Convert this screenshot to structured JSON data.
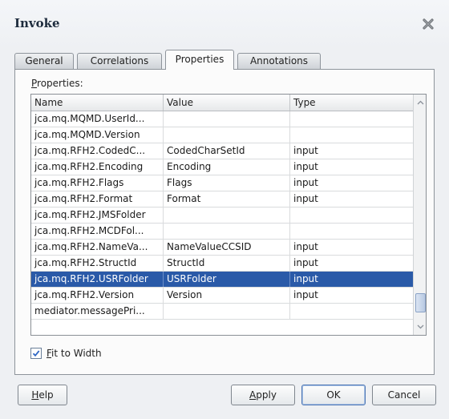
{
  "dialog": {
    "title": "Invoke"
  },
  "tabs": [
    {
      "label": "General",
      "active": false
    },
    {
      "label": "Correlations",
      "active": false
    },
    {
      "label": "Properties",
      "active": true
    },
    {
      "label": "Annotations",
      "active": false
    }
  ],
  "properties": {
    "label_mnemonic": "P",
    "label_rest": "roperties:",
    "columns": [
      "Name",
      "Value",
      "Type"
    ],
    "rows": [
      {
        "name": "jca.mq.MQMD.UserId...",
        "value": "",
        "type": ""
      },
      {
        "name": "jca.mq.MQMD.Version",
        "value": "",
        "type": ""
      },
      {
        "name": "jca.mq.RFH2.CodedC...",
        "value": "CodedCharSetId",
        "type": "input"
      },
      {
        "name": "jca.mq.RFH2.Encoding",
        "value": "Encoding",
        "type": "input"
      },
      {
        "name": "jca.mq.RFH2.Flags",
        "value": "Flags",
        "type": "input"
      },
      {
        "name": "jca.mq.RFH2.Format",
        "value": "Format",
        "type": "input"
      },
      {
        "name": "jca.mq.RFH2.JMSFolder",
        "value": "",
        "type": ""
      },
      {
        "name": "jca.mq.RFH2.MCDFol...",
        "value": "",
        "type": ""
      },
      {
        "name": "jca.mq.RFH2.NameVa...",
        "value": "NameValueCCSID",
        "type": "input"
      },
      {
        "name": "jca.mq.RFH2.StructId",
        "value": "StructId",
        "type": "input"
      },
      {
        "name": "jca.mq.RFH2.USRFolder",
        "value": "USRFolder",
        "type": "input",
        "selected": true
      },
      {
        "name": "jca.mq.RFH2.Version",
        "value": "Version",
        "type": "input"
      },
      {
        "name": "mediator.messagePri...",
        "value": "",
        "type": ""
      }
    ]
  },
  "fit_to_width": {
    "mnemonic": "F",
    "rest": "it to Width",
    "checked": true
  },
  "buttons": {
    "help": {
      "mnemonic": "H",
      "rest": "elp"
    },
    "apply": {
      "mnemonic": "A",
      "rest": "pply"
    },
    "ok": "OK",
    "cancel": "Cancel"
  },
  "colors": {
    "selection": "#2a5aa8",
    "check": "#2f67c5"
  }
}
